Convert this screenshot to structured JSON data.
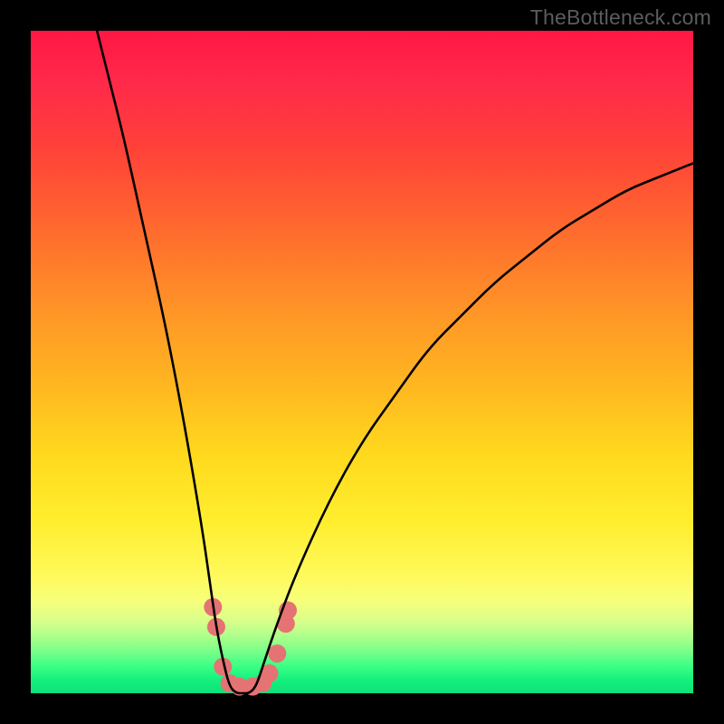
{
  "watermark": "TheBottleneck.com",
  "chart_data": {
    "type": "line",
    "title": "",
    "xlabel": "",
    "ylabel": "",
    "xlim": [
      0,
      100
    ],
    "ylim": [
      0,
      100
    ],
    "series": [
      {
        "name": "bottleneck-curve",
        "color": "#000000",
        "x": [
          10,
          12,
          14,
          16,
          18,
          20,
          22,
          24,
          26,
          27,
          28,
          29,
          30,
          31,
          32,
          33,
          34,
          35,
          37,
          40,
          45,
          50,
          55,
          60,
          65,
          70,
          75,
          80,
          85,
          90,
          95,
          100
        ],
        "y": [
          100,
          92,
          84,
          75,
          66,
          57,
          47,
          36,
          24,
          17,
          10,
          5,
          1,
          0,
          0,
          0,
          1,
          4,
          10,
          18,
          29,
          38,
          45,
          52,
          57,
          62,
          66,
          70,
          73,
          76,
          78,
          80
        ]
      }
    ],
    "markers": {
      "name": "highlight-points",
      "color": "#e57373",
      "radius_px": 10,
      "points_frac": [
        [
          0.275,
          0.87
        ],
        [
          0.28,
          0.9
        ],
        [
          0.29,
          0.96
        ],
        [
          0.3,
          0.985
        ],
        [
          0.315,
          0.99
        ],
        [
          0.335,
          0.99
        ],
        [
          0.35,
          0.985
        ],
        [
          0.36,
          0.97
        ],
        [
          0.372,
          0.94
        ],
        [
          0.385,
          0.895
        ],
        [
          0.388,
          0.875
        ]
      ]
    },
    "gradient_stops": [
      {
        "pos": 0.0,
        "color": "#ff1744"
      },
      {
        "pos": 0.3,
        "color": "#ff6a2e"
      },
      {
        "pos": 0.64,
        "color": "#ffd91e"
      },
      {
        "pos": 0.86,
        "color": "#f7ff7a"
      },
      {
        "pos": 0.96,
        "color": "#39ff85"
      },
      {
        "pos": 1.0,
        "color": "#0ee07a"
      }
    ]
  }
}
